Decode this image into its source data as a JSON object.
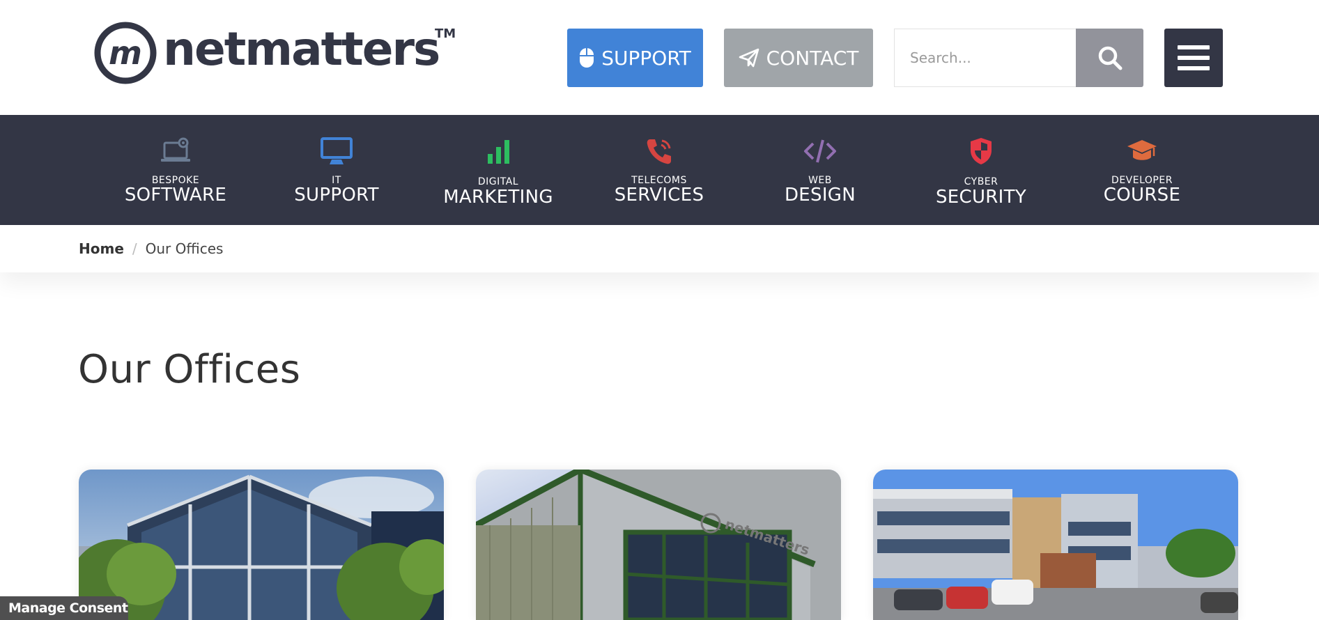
{
  "brand": {
    "name": "netmatters",
    "trademark": "TM",
    "logo_monogram": "m"
  },
  "header": {
    "support_label": "SUPPORT",
    "contact_label": "CONTACT",
    "search_placeholder": "Search...",
    "icons": {
      "support": "mouse-icon",
      "contact": "paper-plane-icon",
      "search": "search-icon",
      "menu": "hamburger-menu-icon"
    }
  },
  "nav": {
    "items": [
      {
        "small": "BESPOKE",
        "big": "SOFTWARE",
        "icon": "laptop-gear-icon",
        "color": "#6b7c93"
      },
      {
        "small": "IT",
        "big": "SUPPORT",
        "icon": "monitor-icon",
        "color": "#4183d7"
      },
      {
        "small": "DIGITAL",
        "big": "MARKETING",
        "icon": "bar-chart-icon",
        "color": "#2dbe60"
      },
      {
        "small": "TELECOMS",
        "big": "SERVICES",
        "icon": "phone-icon",
        "color": "#d64541"
      },
      {
        "small": "WEB",
        "big": "DESIGN",
        "icon": "code-icon",
        "color": "#926fb1"
      },
      {
        "small": "CYBER",
        "big": "SECURITY",
        "icon": "shield-icon",
        "color": "#e63946"
      },
      {
        "small": "DEVELOPER",
        "big": "COURSE",
        "icon": "graduation-cap-icon",
        "color": "#df6b3e"
      }
    ]
  },
  "breadcrumb": {
    "home": "Home",
    "separator": "/",
    "current": "Our Offices"
  },
  "page": {
    "title": "Our Offices"
  },
  "cards": [
    {
      "image": "glass-office-building-photo"
    },
    {
      "image": "netmatters-branded-building-photo"
    },
    {
      "image": "office-with-car-park-photo"
    }
  ],
  "consent": {
    "label": "Manage Consent"
  },
  "colors": {
    "dark": "#333645",
    "support_blue": "#4183d7",
    "contact_grey": "#a0a5a9",
    "search_grey": "#92939b"
  }
}
